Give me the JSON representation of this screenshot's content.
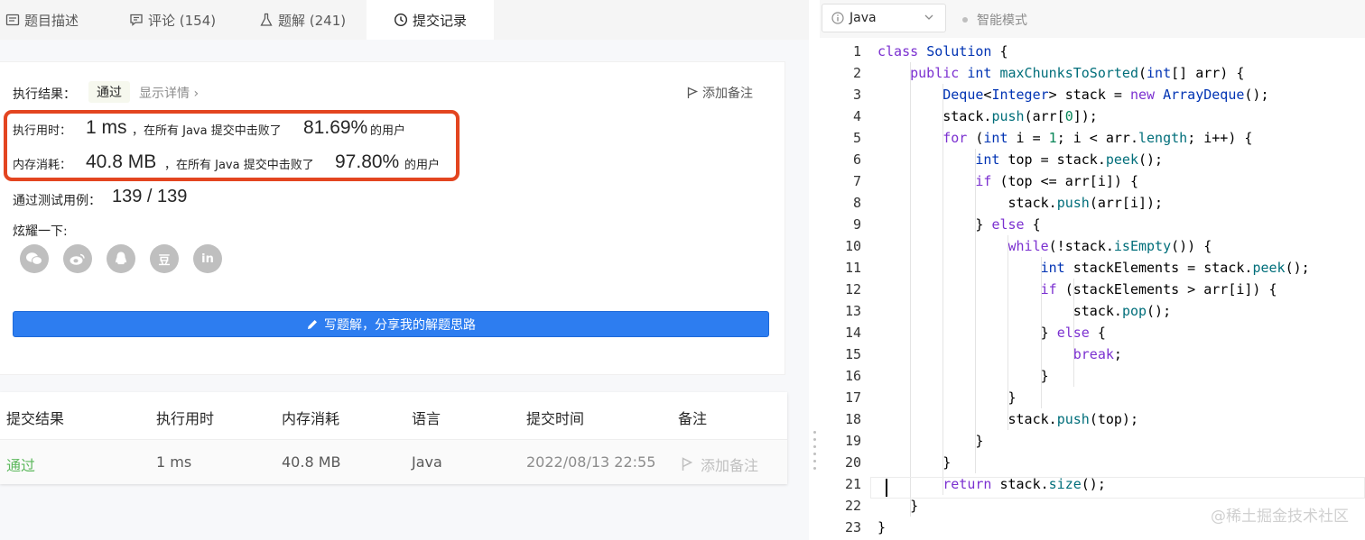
{
  "tabs": [
    {
      "label": "题目描述",
      "icon": "description-icon"
    },
    {
      "label": "评论 (154)",
      "icon": "comment-icon"
    },
    {
      "label": "题解 (241)",
      "icon": "flask-icon"
    },
    {
      "label": "提交记录",
      "icon": "clock-icon"
    }
  ],
  "result": {
    "label": "执行结果：",
    "status": "通过",
    "detail_link": "显示详情 ›",
    "add_note": "添加备注",
    "runtime_label": "执行用时：",
    "runtime_value": "1 ms",
    "runtime_text": "，在所有 Java 提交中击败了",
    "runtime_percent": "81.69%",
    "runtime_suffix": "的用户",
    "memory_label": "内存消耗：",
    "memory_value": "40.8 MB",
    "memory_text": "，在所有 Java 提交中击败了",
    "memory_percent": "97.80%",
    "memory_suffix": "的用户",
    "tests_label": "通过测试用例：",
    "tests_value": "139 / 139",
    "share_label": "炫耀一下:",
    "share_icons": [
      "wechat-icon",
      "weibo-icon",
      "qq-icon",
      "douban-icon",
      "linkedin-icon"
    ],
    "share_glyphs": [
      "",
      "",
      "",
      "豆",
      "in"
    ],
    "write_solution": "写题解，分享我的解题思路"
  },
  "table": {
    "headers": [
      "提交结果",
      "执行用时",
      "内存消耗",
      "语言",
      "提交时间",
      "备注"
    ],
    "row": {
      "status": "通过",
      "runtime": "1 ms",
      "memory": "40.8 MB",
      "language": "Java",
      "time": "2022/08/13 22:55",
      "note": "添加备注"
    }
  },
  "editor": {
    "language": "Java",
    "mode": "智能模式",
    "lines": [
      "class Solution {",
      "    public int maxChunksToSorted(int[] arr) {",
      "        Deque<Integer> stack = new ArrayDeque();",
      "        stack.push(arr[0]);",
      "        for (int i = 1; i < arr.length; i++) {",
      "            int top = stack.peek();",
      "            if (top <= arr[i]) {",
      "                stack.push(arr[i]);",
      "            } else {",
      "                while(!stack.isEmpty()) {",
      "                    int stackElements = stack.peek();",
      "                    if (stackElements > arr[i]) {",
      "                        stack.pop();",
      "                    } else {",
      "                        break;",
      "                    }",
      "                }",
      "                stack.push(top);",
      "            }",
      "        }",
      "        return stack.size();",
      "    }",
      "}"
    ]
  },
  "watermark": "@稀土掘金技术社区",
  "colors": {
    "accent": "#2d7df0",
    "success": "#5cb85c",
    "highlight_box": "#e34520",
    "keyword": "#7b30d0",
    "type": "#0033b3",
    "function": "#006e7a"
  }
}
